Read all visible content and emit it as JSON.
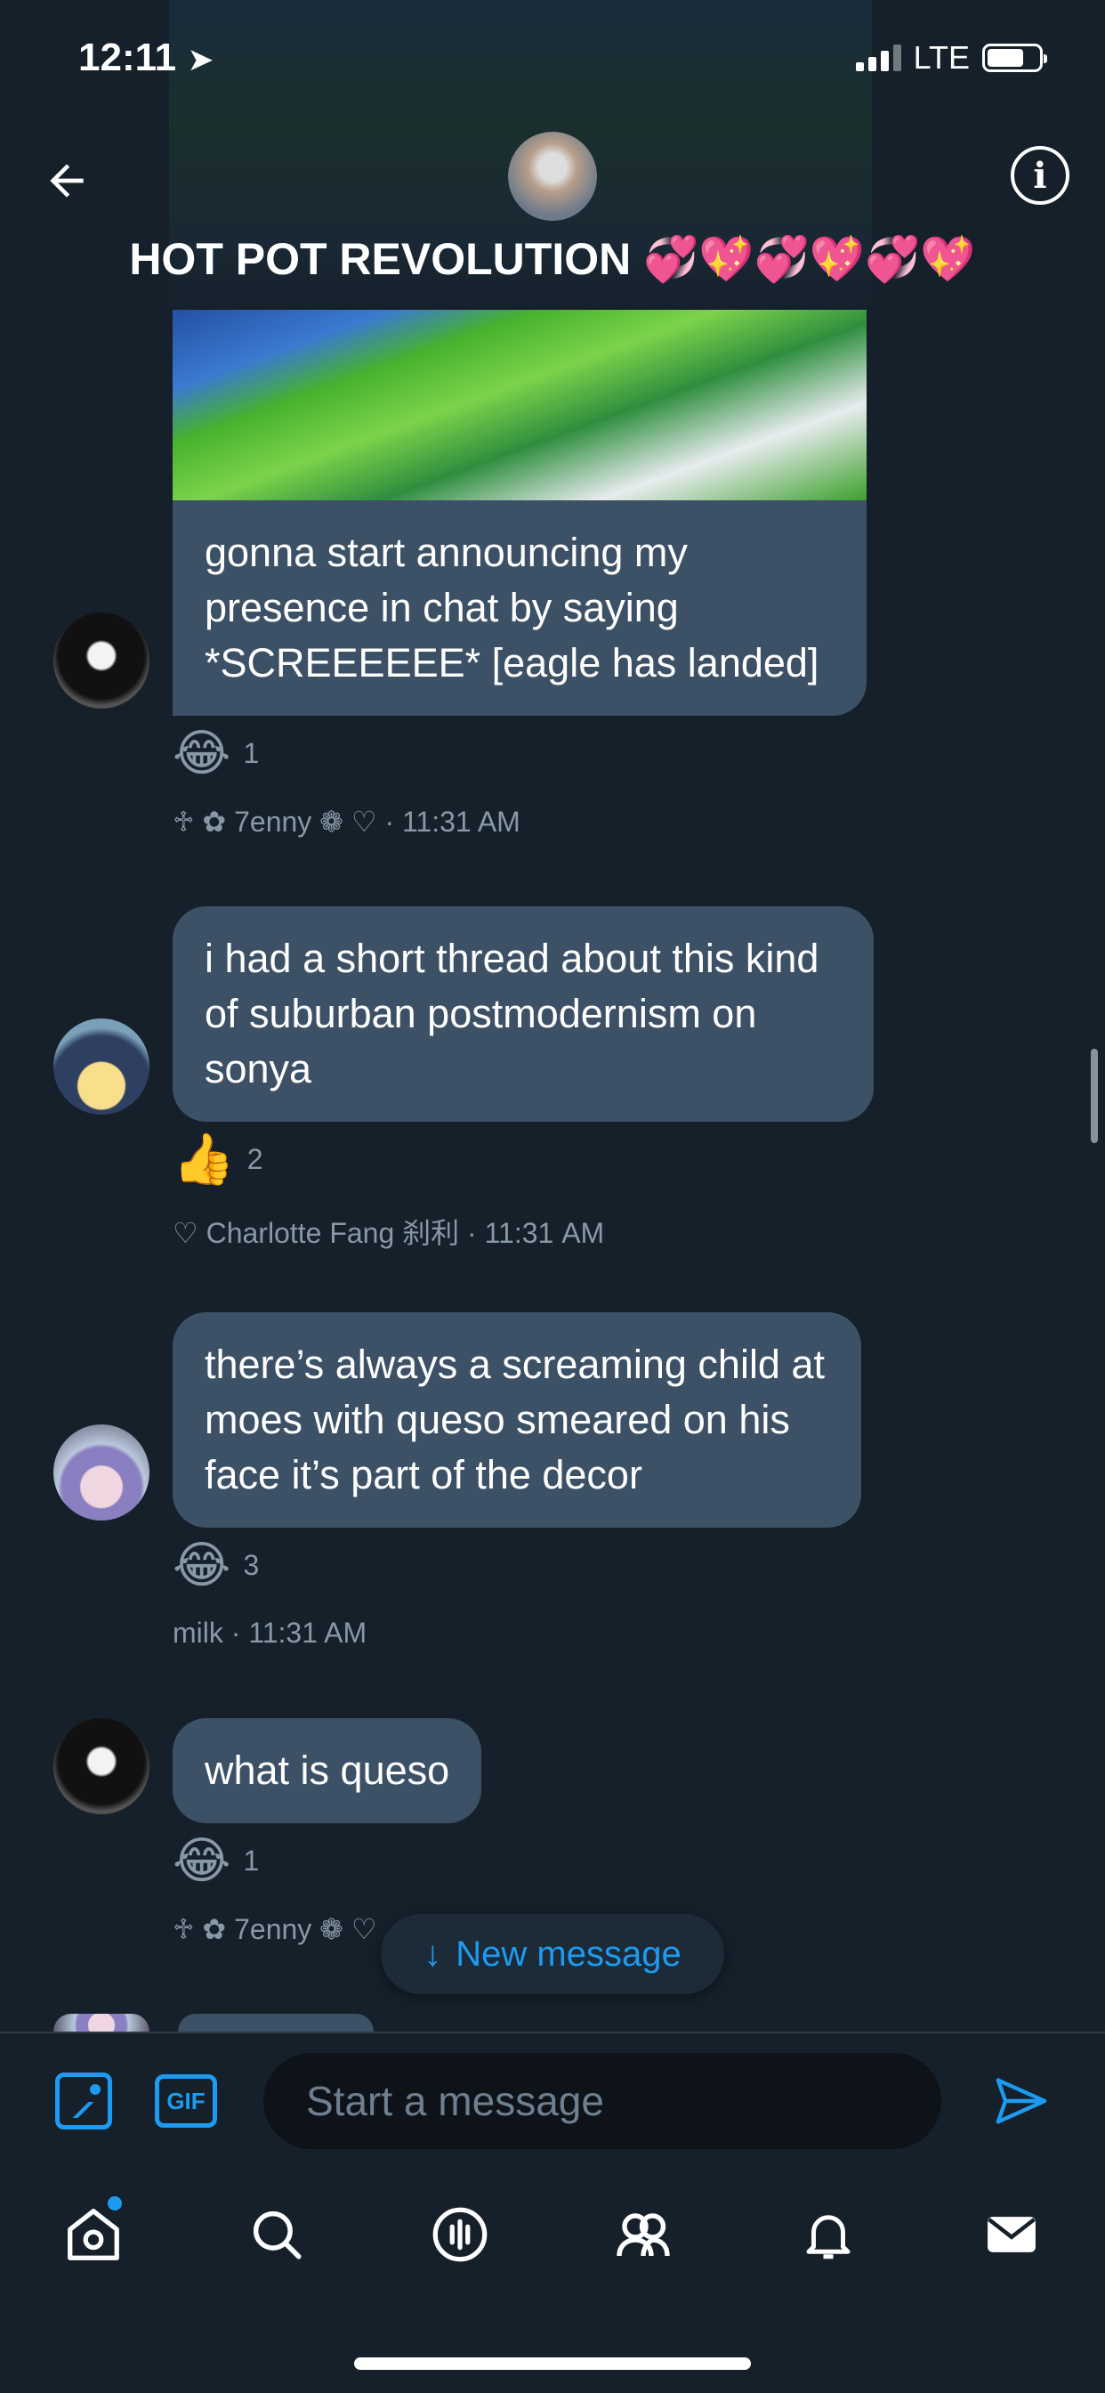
{
  "status_bar": {
    "time": "12:11",
    "network": "LTE"
  },
  "header": {
    "title": "HOT POT REVOLUTION 💞💖💞💖💞💖"
  },
  "messages": [
    {
      "text": "gonna start announcing my presence in chat by saying *SCREEEEEE* [eagle has landed]",
      "reaction_emoji": "😂",
      "reaction_count": "1",
      "sender": "♱ ✿ 7enny ❁ ♡",
      "time": "· 11:31 AM"
    },
    {
      "text": "i had a short thread about this kind of suburban postmodernism on sonya",
      "reaction_emoji": "👍",
      "reaction_count": "2",
      "sender": "♡ Charlotte Fang 刹利",
      "time": "· 11:31 AM"
    },
    {
      "text": "there’s always a screaming child at moes with queso smeared on his face it’s part of the decor",
      "reaction_emoji": "😂",
      "reaction_count": "3",
      "sender": "milk",
      "time": "· 11:31 AM"
    },
    {
      "text": "what is queso",
      "reaction_emoji": "😂",
      "reaction_count": "1",
      "sender": "♱ ✿ 7enny ❁ ♡",
      "time": ""
    }
  ],
  "new_message_pill": {
    "arrow": "↓",
    "label": "New message"
  },
  "compose": {
    "gif_label": "GIF",
    "placeholder": "Start a message"
  },
  "colors": {
    "background": "#15202b",
    "bubble": "#3d5166",
    "accent": "#1d9bf0",
    "muted": "#8899a6"
  },
  "icons": [
    "back-arrow-icon",
    "info-icon",
    "image-icon",
    "gif-icon",
    "send-icon",
    "home-icon",
    "search-icon",
    "spaces-icon",
    "communities-icon",
    "notifications-icon",
    "messages-icon"
  ]
}
